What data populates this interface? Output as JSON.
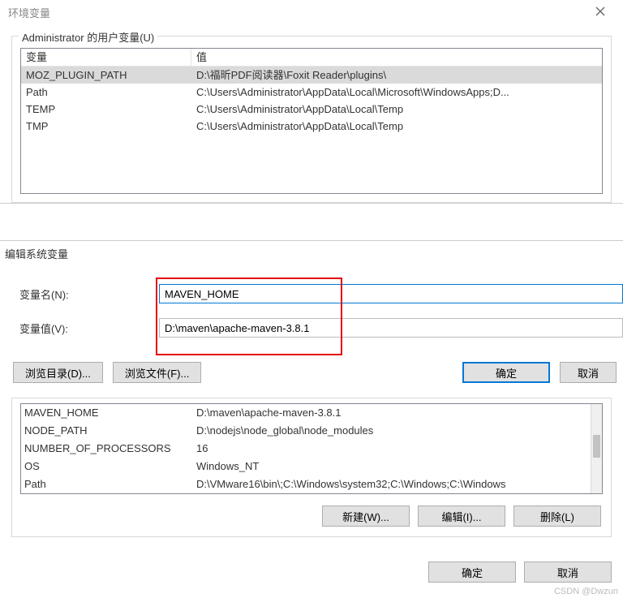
{
  "window": {
    "title": "环境变量"
  },
  "user_vars": {
    "group_label": "Administrator 的用户变量(U)",
    "header": {
      "name": "变量",
      "value": "值"
    },
    "rows": [
      {
        "name": "MOZ_PLUGIN_PATH",
        "value": "D:\\福昕PDF阅读器\\Foxit Reader\\plugins\\"
      },
      {
        "name": "Path",
        "value": "C:\\Users\\Administrator\\AppData\\Local\\Microsoft\\WindowsApps;D..."
      },
      {
        "name": "TEMP",
        "value": "C:\\Users\\Administrator\\AppData\\Local\\Temp"
      },
      {
        "name": "TMP",
        "value": "C:\\Users\\Administrator\\AppData\\Local\\Temp"
      }
    ]
  },
  "edit_dialog": {
    "title": "编辑系统变量",
    "name_label": "变量名(N):",
    "value_label": "变量值(V):",
    "name_value": "MAVEN_HOME",
    "value_value": "D:\\maven\\apache-maven-3.8.1",
    "browse_dir": "浏览目录(D)...",
    "browse_file": "浏览文件(F)...",
    "ok": "确定",
    "cancel": "取消"
  },
  "system_vars": {
    "rows": [
      {
        "name": "MAVEN_HOME",
        "value": "D:\\maven\\apache-maven-3.8.1"
      },
      {
        "name": "NODE_PATH",
        "value": "D:\\nodejs\\node_global\\node_modules"
      },
      {
        "name": "NUMBER_OF_PROCESSORS",
        "value": "16"
      },
      {
        "name": "OS",
        "value": "Windows_NT"
      },
      {
        "name": "Path",
        "value": "D:\\VMware16\\bin\\;C:\\Windows\\system32;C:\\Windows;C:\\Windows"
      }
    ],
    "new_btn": "新建(W)...",
    "edit_btn": "编辑(I)...",
    "del_btn": "删除(L)"
  },
  "bottom": {
    "ok": "确定",
    "cancel": "取消"
  },
  "watermark": "CSDN @Dwzun"
}
